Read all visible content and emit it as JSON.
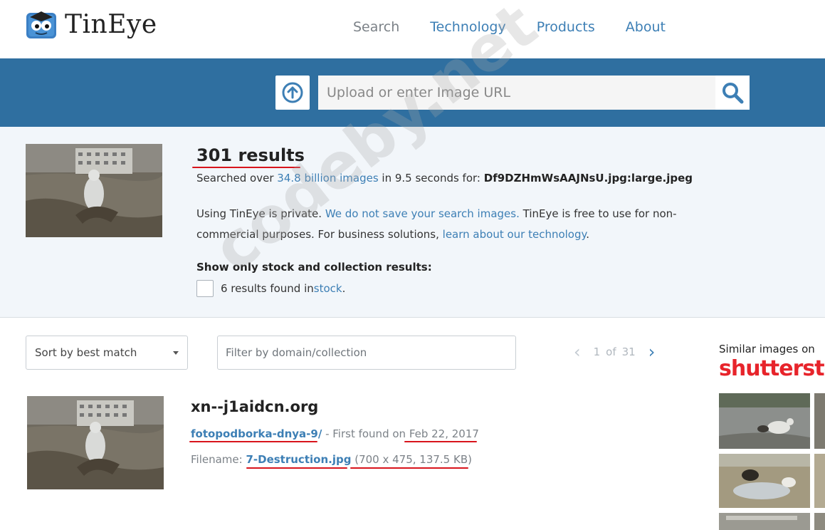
{
  "header": {
    "logo_text": "TinEye",
    "nav": [
      {
        "label": "Search",
        "active": true
      },
      {
        "label": "Technology"
      },
      {
        "label": "Products"
      },
      {
        "label": "About"
      }
    ]
  },
  "search": {
    "placeholder": "Upload or enter Image URL",
    "upload_icon": "upload-arrow-icon",
    "search_icon": "magnifier-icon"
  },
  "summary": {
    "results_count": "301 results",
    "searched_prefix": "Searched over ",
    "searched_link": "34.8 billion images",
    "searched_middle": " in 9.5 seconds for: ",
    "searched_file": "Df9DZHmWsAAJNsU.jpg:large.jpeg",
    "privacy_prefix": "Using TinEye is private. ",
    "privacy_link": "We do not save your search images.",
    "privacy_middle": " TinEye is free to use for non-commercial purposes. For business solutions, ",
    "privacy_link2": "learn about our technology",
    "privacy_suffix": ".",
    "stock_title": "Show only stock and collection results:",
    "stock_prefix": "6 results found in ",
    "stock_link": "stock",
    "stock_suffix": "."
  },
  "controls": {
    "sort_value": "Sort by best match",
    "filter_placeholder": "Filter by domain/collection",
    "page_current": "1",
    "page_of": "of",
    "page_total": "31"
  },
  "result": {
    "domain": "xn--j1aidcn.org",
    "page_link": "fotopodborka-dnya-9/",
    "first_found_prefix": " - First found on ",
    "first_found_date": "Feb 22, 2017",
    "filename_label": "Filename: ",
    "filename_link": "7-Destruction.jpg",
    "file_meta": "(700 x 475, 137.5 KB)"
  },
  "sidebar": {
    "similar_label": "Similar images on",
    "brand": "shutterstock"
  },
  "watermark": "codeby.net",
  "colors": {
    "accent": "#3d7fb5",
    "band": "#2f6fa0",
    "annotation": "#d8141c",
    "brand_red": "#e7242b"
  }
}
